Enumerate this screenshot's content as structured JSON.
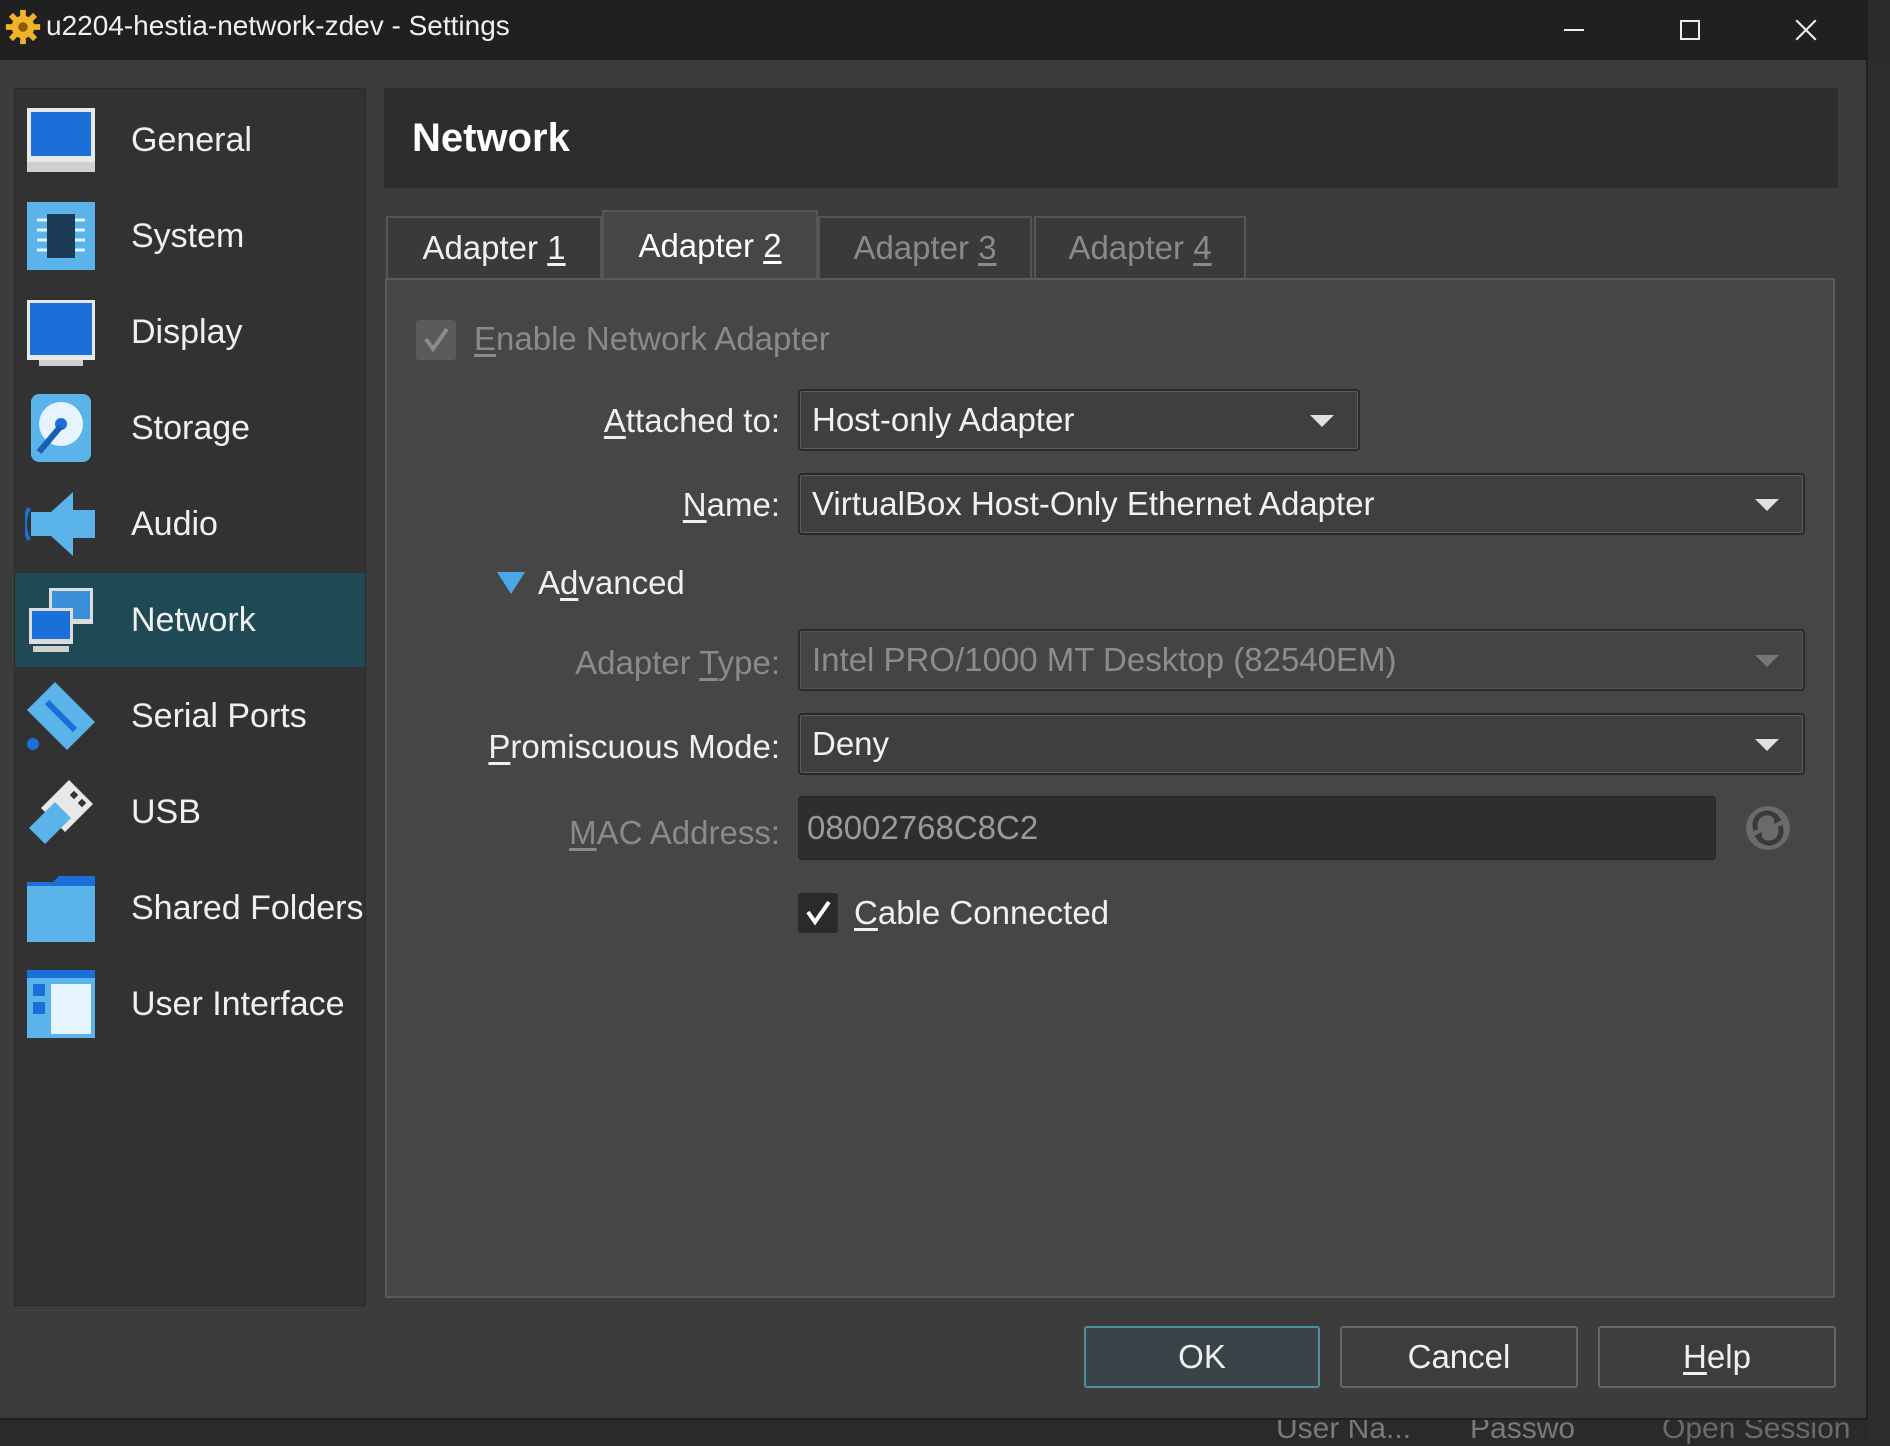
{
  "window": {
    "title": "u2204-hestia-network-zdev - Settings"
  },
  "sidebar": {
    "items": [
      {
        "label": "General",
        "icon": "monitor-icon",
        "selected": false
      },
      {
        "label": "System",
        "icon": "chip-icon",
        "selected": false
      },
      {
        "label": "Display",
        "icon": "display-icon",
        "selected": false
      },
      {
        "label": "Storage",
        "icon": "disk-icon",
        "selected": false
      },
      {
        "label": "Audio",
        "icon": "speaker-icon",
        "selected": false
      },
      {
        "label": "Network",
        "icon": "network-icon",
        "selected": true
      },
      {
        "label": "Serial Ports",
        "icon": "serial-port-icon",
        "selected": false
      },
      {
        "label": "USB",
        "icon": "usb-icon",
        "selected": false
      },
      {
        "label": "Shared Folders",
        "icon": "folder-icon",
        "selected": false
      },
      {
        "label": "User Interface",
        "icon": "window-layout-icon",
        "selected": false
      }
    ]
  },
  "header": {
    "title": "Network"
  },
  "tabs": [
    {
      "pre": "Adapter ",
      "key": "1",
      "active": false,
      "enabled": true
    },
    {
      "pre": "Adapter ",
      "key": "2",
      "active": true,
      "enabled": true
    },
    {
      "pre": "Adapter ",
      "key": "3",
      "active": false,
      "enabled": false
    },
    {
      "pre": "Adapter ",
      "key": "4",
      "active": false,
      "enabled": false
    }
  ],
  "adapter": {
    "enable_pre": "",
    "enable_key": "E",
    "enable_post": "nable Network Adapter",
    "enable_checked": true,
    "attached_pre": "",
    "attached_key": "A",
    "attached_post": "ttached to:",
    "attached_value": "Host-only Adapter",
    "name_pre": "",
    "name_key": "N",
    "name_post": "ame:",
    "name_value": "VirtualBox Host-Only Ethernet Adapter",
    "advanced_pre": "A",
    "advanced_key": "d",
    "advanced_post": "vanced",
    "adapter_type_pre": "Adapter ",
    "adapter_type_key": "T",
    "adapter_type_post": "ype:",
    "adapter_type_value": "Intel PRO/1000 MT Desktop (82540EM)",
    "promisc_pre": "",
    "promisc_key": "P",
    "promisc_post": "romiscuous Mode:",
    "promisc_value": "Deny",
    "mac_pre": "",
    "mac_key": "M",
    "mac_post": "AC Address:",
    "mac_value": "08002768C8C2",
    "cable_pre": "",
    "cable_key": "C",
    "cable_post": "able Connected",
    "cable_checked": true
  },
  "buttons": {
    "ok": "OK",
    "cancel": "Cancel",
    "help_key": "H",
    "help_post": "elp"
  },
  "background": {
    "user_name": "User Na...",
    "password": "Passwo",
    "open_session": "Open Session"
  },
  "colors": {
    "selected_bg": "#1f4a55",
    "accent": "#4f8fa3",
    "icon_blue": "#2d8cd6"
  }
}
